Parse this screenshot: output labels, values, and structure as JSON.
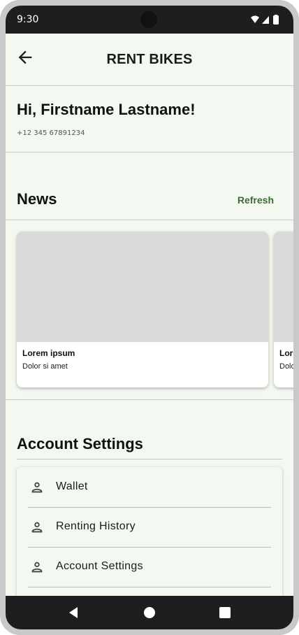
{
  "status_bar": {
    "time": "9:30",
    "icons": [
      "wifi-icon",
      "signal-icon",
      "battery-icon"
    ]
  },
  "app_bar": {
    "title": "RENT BIKES",
    "back_icon": "arrow-back-icon"
  },
  "user": {
    "greeting": "Hi, Firstname Lastname!",
    "phone": "+12 345 67891234"
  },
  "news": {
    "title": "News",
    "refresh_label": "Refresh",
    "cards": [
      {
        "title": "Lorem ipsum",
        "subtitle": "Dolor si amet"
      },
      {
        "title": "Lorem ipsum",
        "subtitle": "Dolor si amet"
      }
    ]
  },
  "account": {
    "title": "Account Settings",
    "items": [
      {
        "label": "Wallet",
        "icon": "person-icon"
      },
      {
        "label": "Renting History",
        "icon": "person-icon"
      },
      {
        "label": "Account Settings",
        "icon": "person-icon"
      }
    ]
  },
  "nav_bar": {
    "buttons": [
      "back-triangle-icon",
      "home-circle-icon",
      "recents-square-icon"
    ]
  },
  "colors": {
    "background": "#f3f8f0",
    "accent": "#3b6b35",
    "system_bars": "#1f1d20",
    "card_placeholder": "#d9d9d9"
  }
}
